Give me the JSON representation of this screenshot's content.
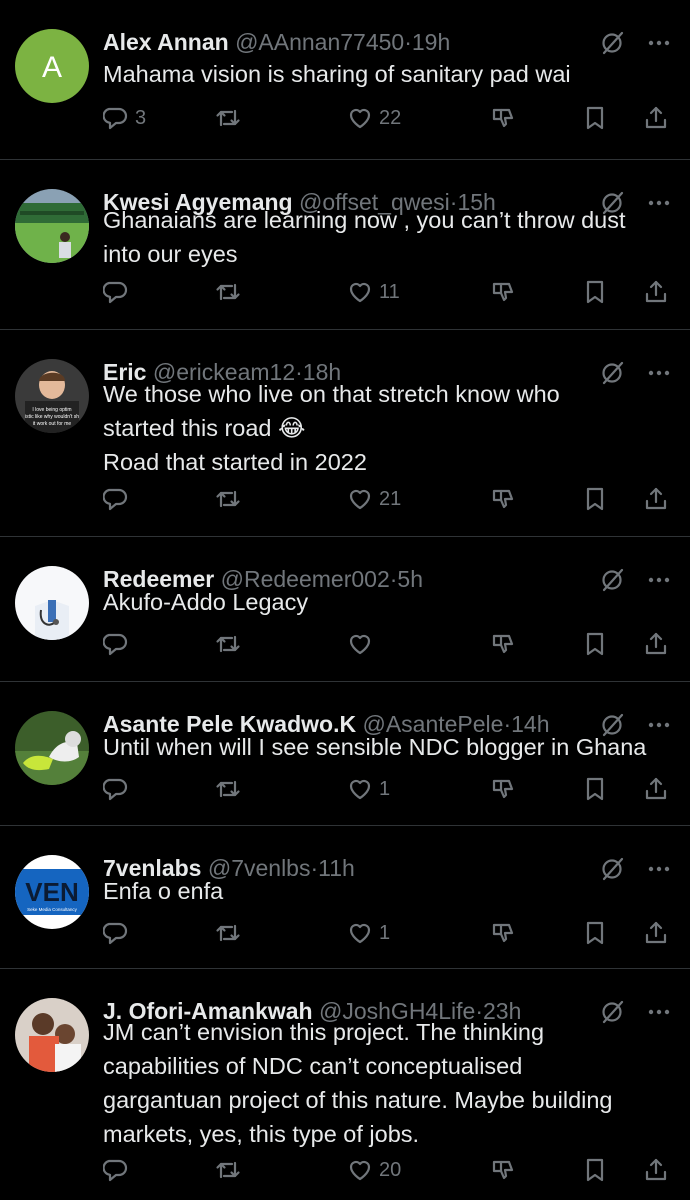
{
  "tweets": [
    {
      "name": "Alex Annan",
      "handle": "@AAnnan77450",
      "time": "19h",
      "text": "Mahama vision is sharing of sanitary pad wai",
      "replies": "3",
      "reposts": "",
      "likes": "22",
      "avatar": {
        "type": "letter",
        "letter": "A",
        "color": "#7cb342"
      }
    },
    {
      "name": "Kwesi Agyemang",
      "handle": "@offset_qwesi",
      "time": "15h",
      "text": "Ghanaians are learning now , you can’t throw dust\ninto our eyes",
      "replies": "",
      "reposts": "",
      "likes": "11",
      "avatar": {
        "type": "photo-field"
      }
    },
    {
      "name": "Eric",
      "handle": "@erickeam12",
      "time": "18h",
      "text": "We those who live on that stretch know who\nstarted this road 😂\nRoad that started in 2022",
      "replies": "",
      "reposts": "",
      "likes": "21",
      "avatar": {
        "type": "photo-person",
        "caption": "I love being optimistic like why wouldn't shit work out for me"
      }
    },
    {
      "name": "Redeemer",
      "handle": "@Redeemer002",
      "time": "5h",
      "text": "Akufo-Addo Legacy",
      "replies": "",
      "reposts": "",
      "likes": "",
      "avatar": {
        "type": "photo-doctor"
      }
    },
    {
      "name": "Asante Pele Kwadwo.K",
      "handle": "@AsantePele",
      "time": "14h",
      "text": "Until when will I see sensible NDC blogger in Ghana",
      "replies": "",
      "reposts": "",
      "likes": "1",
      "avatar": {
        "type": "photo-boots"
      }
    },
    {
      "name": "7venlabs",
      "handle": "@7venlbs",
      "time": "11h",
      "text": "Enfa o enfa",
      "replies": "",
      "reposts": "",
      "likes": "1",
      "avatar": {
        "type": "logo",
        "logo_text": "VEN",
        "logo_sub": "Seke Media Consultancy",
        "color": "#1565c0"
      }
    },
    {
      "name": "J. Ofori-Amankwah",
      "handle": "@JoshGH4Life",
      "time": "23h",
      "text": "JM can’t envision this project. The thinking\ncapabilities of NDC can’t conceptualised\ngargantuan project of this nature. Maybe building\nmarkets, yes, this type of jobs.",
      "replies": "",
      "reposts": "",
      "likes": "20",
      "avatar": {
        "type": "photo-kids"
      }
    }
  ],
  "dot": "·",
  "colors": {
    "bg": "#000000",
    "text": "#e7e9ea",
    "muted": "#71767b",
    "divider": "#2f3336"
  }
}
